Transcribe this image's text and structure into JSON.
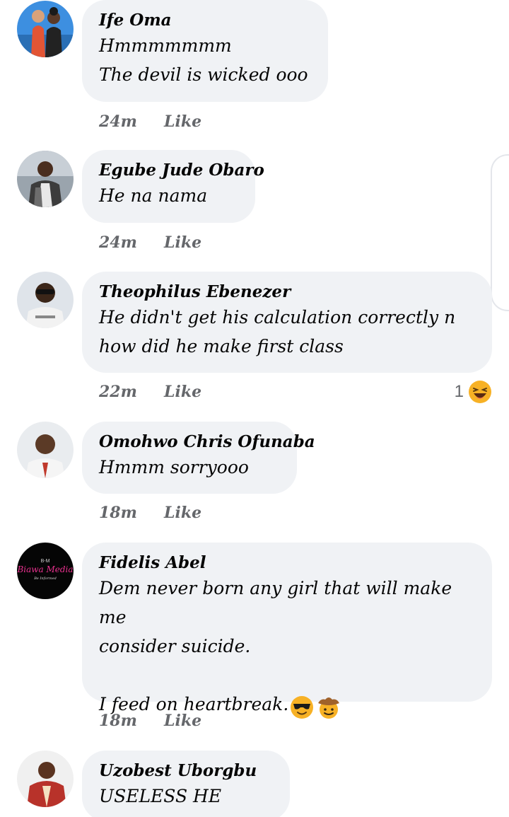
{
  "comments": [
    {
      "name": "Ife Oma",
      "lines": "Hmmmmmmm\nThe devil is wicked ooo",
      "time": "24m",
      "like": "Like",
      "avatar_icon": "avatar-photo-couple"
    },
    {
      "name": "Egube Jude Obaro",
      "lines": "He na nama",
      "time": "24m",
      "like": "Like",
      "avatar_icon": "avatar-photo-man-suit"
    },
    {
      "name": "Theophilus Ebenezer",
      "lines": "He didn't get his calculation correctly n\nhow did he make first class",
      "time": "22m",
      "like": "Like",
      "reaction_count": "1",
      "reaction_icon": "laughing-emoji-icon",
      "avatar_icon": "avatar-photo-man-sunglasses"
    },
    {
      "name": "Omohwo Chris Ofunaba",
      "lines": "Hmmm sorryooo",
      "time": "18m",
      "like": "Like",
      "avatar_icon": "avatar-photo-man"
    },
    {
      "name": "Fidelis Abel",
      "lines": "Dem never born any girl that will make me\nconsider suicide.\n\nI feed on heartbreak.",
      "time": "18m",
      "like": "Like",
      "inline_emojis": [
        "sunglasses-emoji-icon",
        "cowboy-emoji-icon"
      ],
      "avatar_icon": "avatar-logo",
      "avatar_logo_text": "Biawa Media",
      "avatar_logo_small": "B-M",
      "avatar_logo_tagline": "Be Informed"
    },
    {
      "name": "Uzobest Uborgbu",
      "lines": "USELESS HE GOAT.",
      "avatar_icon": "avatar-photo-man-red"
    }
  ],
  "colors": {
    "bubble": "#f0f2f5",
    "text": "#050505",
    "meta": "#65676b",
    "laugh_emoji": "#f7b125",
    "logo_pink": "#e9318f"
  }
}
